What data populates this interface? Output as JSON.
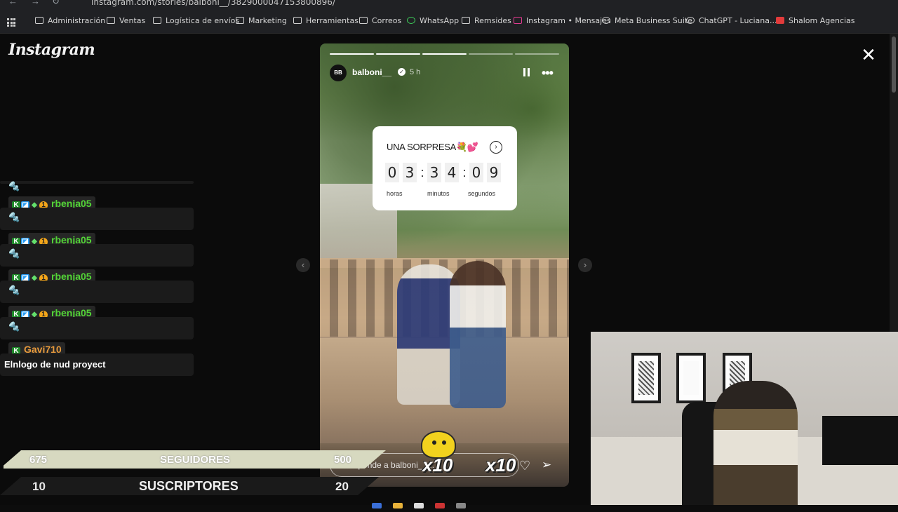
{
  "browser": {
    "url": "instagram.com/stories/balboni__/3829000047153800896/",
    "bookmarks": [
      {
        "label": "Administración",
        "icon": "folder-icon"
      },
      {
        "label": "Ventas",
        "icon": "folder-icon"
      },
      {
        "label": "Logística de envíos",
        "icon": "folder-icon"
      },
      {
        "label": "Marketing",
        "icon": "folder-icon"
      },
      {
        "label": "Herramientas",
        "icon": "folder-icon"
      },
      {
        "label": "Correos",
        "icon": "folder-icon"
      },
      {
        "label": "WhatsApp",
        "icon": "whatsapp-icon"
      },
      {
        "label": "Remsides",
        "icon": "sheet-icon"
      },
      {
        "label": "Instagram • Mensajes",
        "icon": "instagram-icon"
      },
      {
        "label": "Meta Business Suite",
        "icon": "meta-icon"
      },
      {
        "label": "ChatGPT - Luciana...",
        "icon": "chatgpt-icon"
      },
      {
        "label": "Shalom Agencias",
        "icon": "shalom-icon"
      }
    ]
  },
  "instagram": {
    "logo": "Instagram",
    "close_label": "✕"
  },
  "story": {
    "username": "balboni__",
    "avatar_text": "BB",
    "time": "5 h",
    "countdown": {
      "title": "UNA SORPRESA💐💕",
      "digits": [
        "0",
        "3",
        "3",
        "4",
        "0",
        "9"
      ],
      "labels": [
        "horas",
        "minutos",
        "segundos"
      ]
    },
    "reply_placeholder": "Responde a balboni__..."
  },
  "chat": {
    "messages": [
      {
        "user": "rbenja05",
        "text": "🔩",
        "color": "#53d437"
      },
      {
        "user": "rbenja05",
        "text": "🔩",
        "color": "#53d437"
      },
      {
        "user": "rbenja05",
        "text": "🔩",
        "color": "#53d437"
      },
      {
        "user": "rbenja05",
        "text": "🔩",
        "color": "#53d437"
      },
      {
        "user": "Gavi710",
        "text": "Elnlogo de nud proyect",
        "color": "#e79a3c"
      }
    ]
  },
  "overlay": {
    "followers": {
      "current": "675",
      "label": "SEGUIDORES",
      "goal": "500"
    },
    "subscribers": {
      "current": "10",
      "label": "SUSCRIPTORES",
      "goal": "20"
    },
    "multipliers": [
      "x10",
      "x10"
    ]
  }
}
